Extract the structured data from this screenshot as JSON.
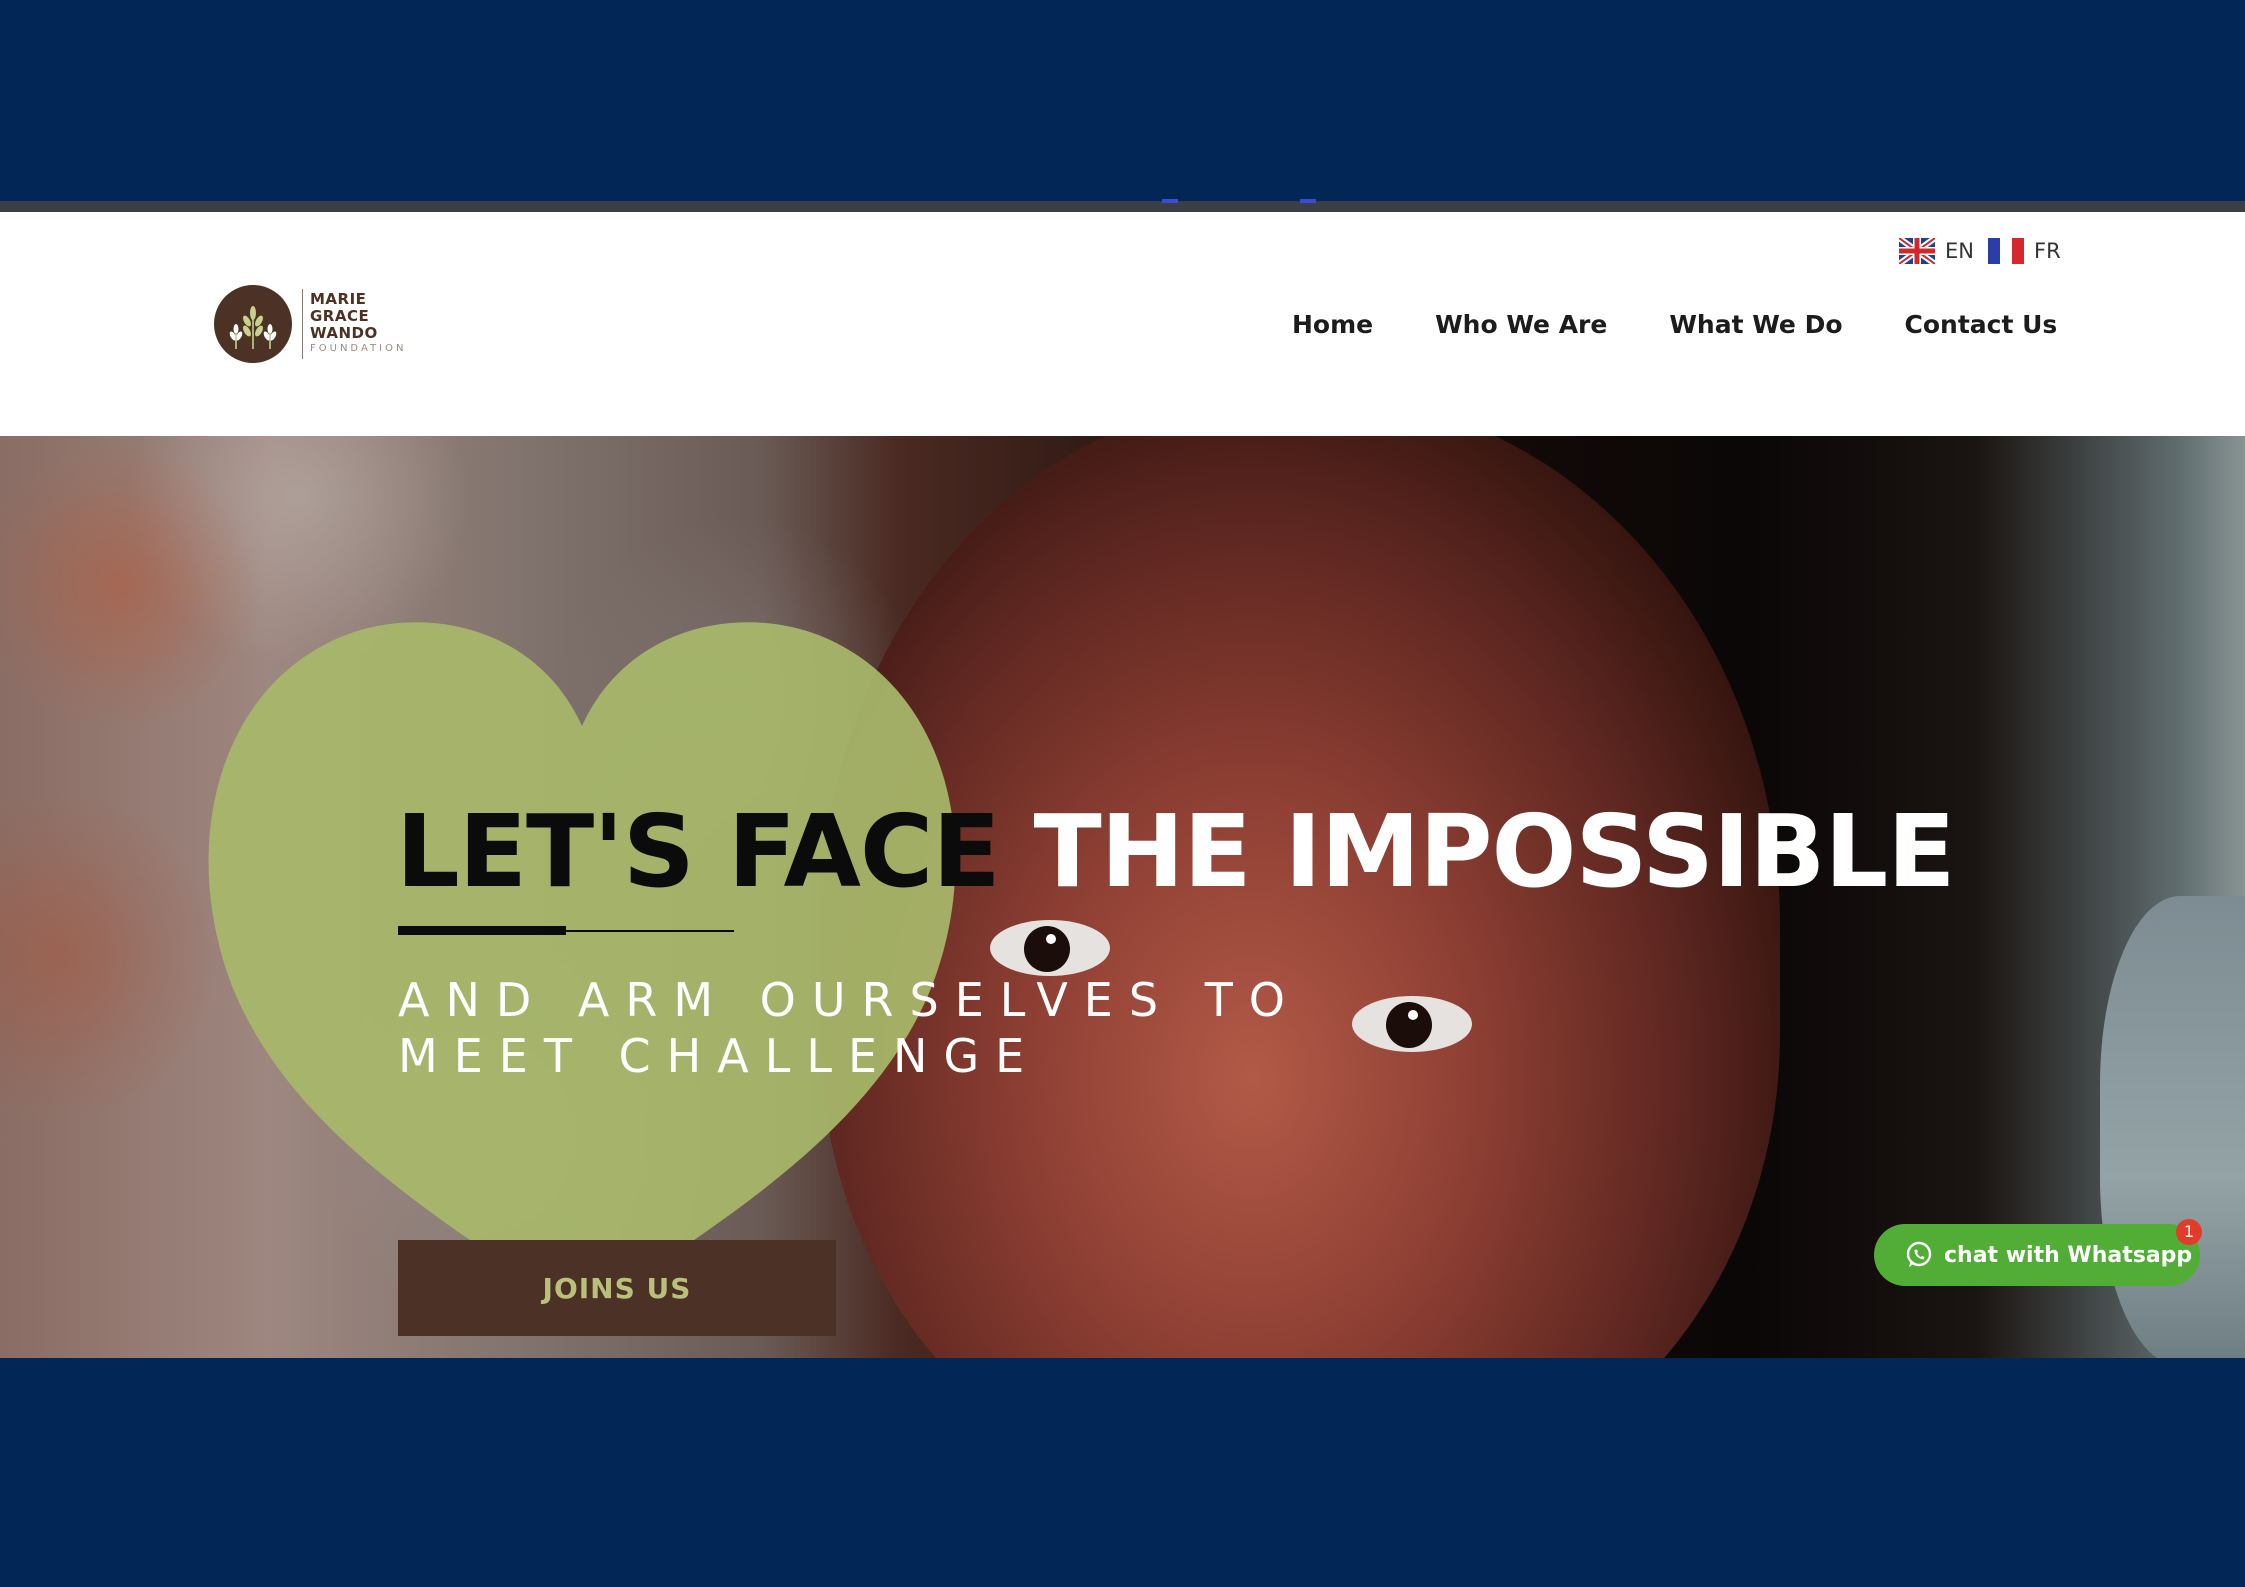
{
  "language_switcher": {
    "en_label": "EN",
    "fr_label": "FR"
  },
  "logo": {
    "line1": "MARIE",
    "line2": "GRACE",
    "line3": "WANDO",
    "line4": "FOUNDATION"
  },
  "nav": {
    "items": [
      {
        "label": "Home"
      },
      {
        "label": "Who We Are"
      },
      {
        "label": "What We Do"
      },
      {
        "label": "Contact Us"
      }
    ]
  },
  "hero": {
    "headline_dark": "LET'S FACE",
    "headline_light": "THE IMPOSSIBLE",
    "subline1": "AND ARM OURSELVES TO",
    "subline2": "MEET CHALLENGE",
    "cta_label": "JOINS US",
    "heart_color": "#a8b86a",
    "cta_color": "#4b3126"
  },
  "whatsapp": {
    "label": "chat with Whatsapp",
    "badge": "1",
    "color": "#52ad37"
  },
  "colors": {
    "frame": "#022656",
    "header_bg": "#ffffff",
    "brand_brown": "#4b3225"
  }
}
